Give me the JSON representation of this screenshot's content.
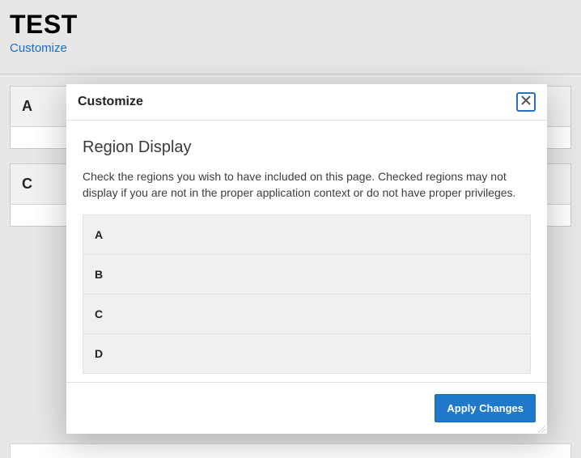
{
  "page": {
    "title": "TEST",
    "customize_link": "Customize"
  },
  "bg_regions": [
    {
      "label": "A"
    },
    {
      "label": "C"
    }
  ],
  "modal": {
    "title": "Customize",
    "section_title": "Region Display",
    "section_desc": "Check the regions you wish to have included on this page. Checked regions may not display if you are not in the proper application context or do not have proper privileges.",
    "regions": [
      {
        "label": "A"
      },
      {
        "label": "B"
      },
      {
        "label": "C"
      },
      {
        "label": "D"
      }
    ],
    "apply_label": "Apply Changes"
  }
}
